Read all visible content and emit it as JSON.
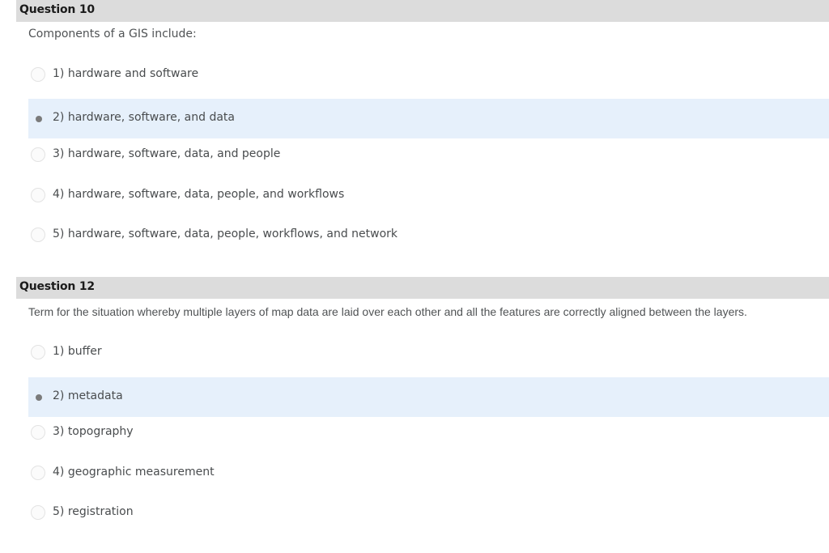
{
  "questions": [
    {
      "title": "Question 10",
      "text": "Components of a GIS include:",
      "selected_index": 1,
      "options": [
        {
          "label": "1)  hardware and software"
        },
        {
          "label": "2)  hardware, software, and data"
        },
        {
          "label": "3)  hardware, software, data, and people"
        },
        {
          "label": "4)  hardware, software, data, people, and workflows"
        },
        {
          "label": "5)  hardware, software, data, people, workflows, and network"
        }
      ]
    },
    {
      "title": "Question 12",
      "text": "Term for the situation whereby multiple layers of map data are laid over each other and all the features are correctly aligned between the layers.",
      "selected_index": 1,
      "options": [
        {
          "label": "1)  buffer"
        },
        {
          "label": "2)  metadata"
        },
        {
          "label": "3)  topography"
        },
        {
          "label": "4)  geographic measurement"
        },
        {
          "label": "5)  registration"
        }
      ]
    }
  ]
}
